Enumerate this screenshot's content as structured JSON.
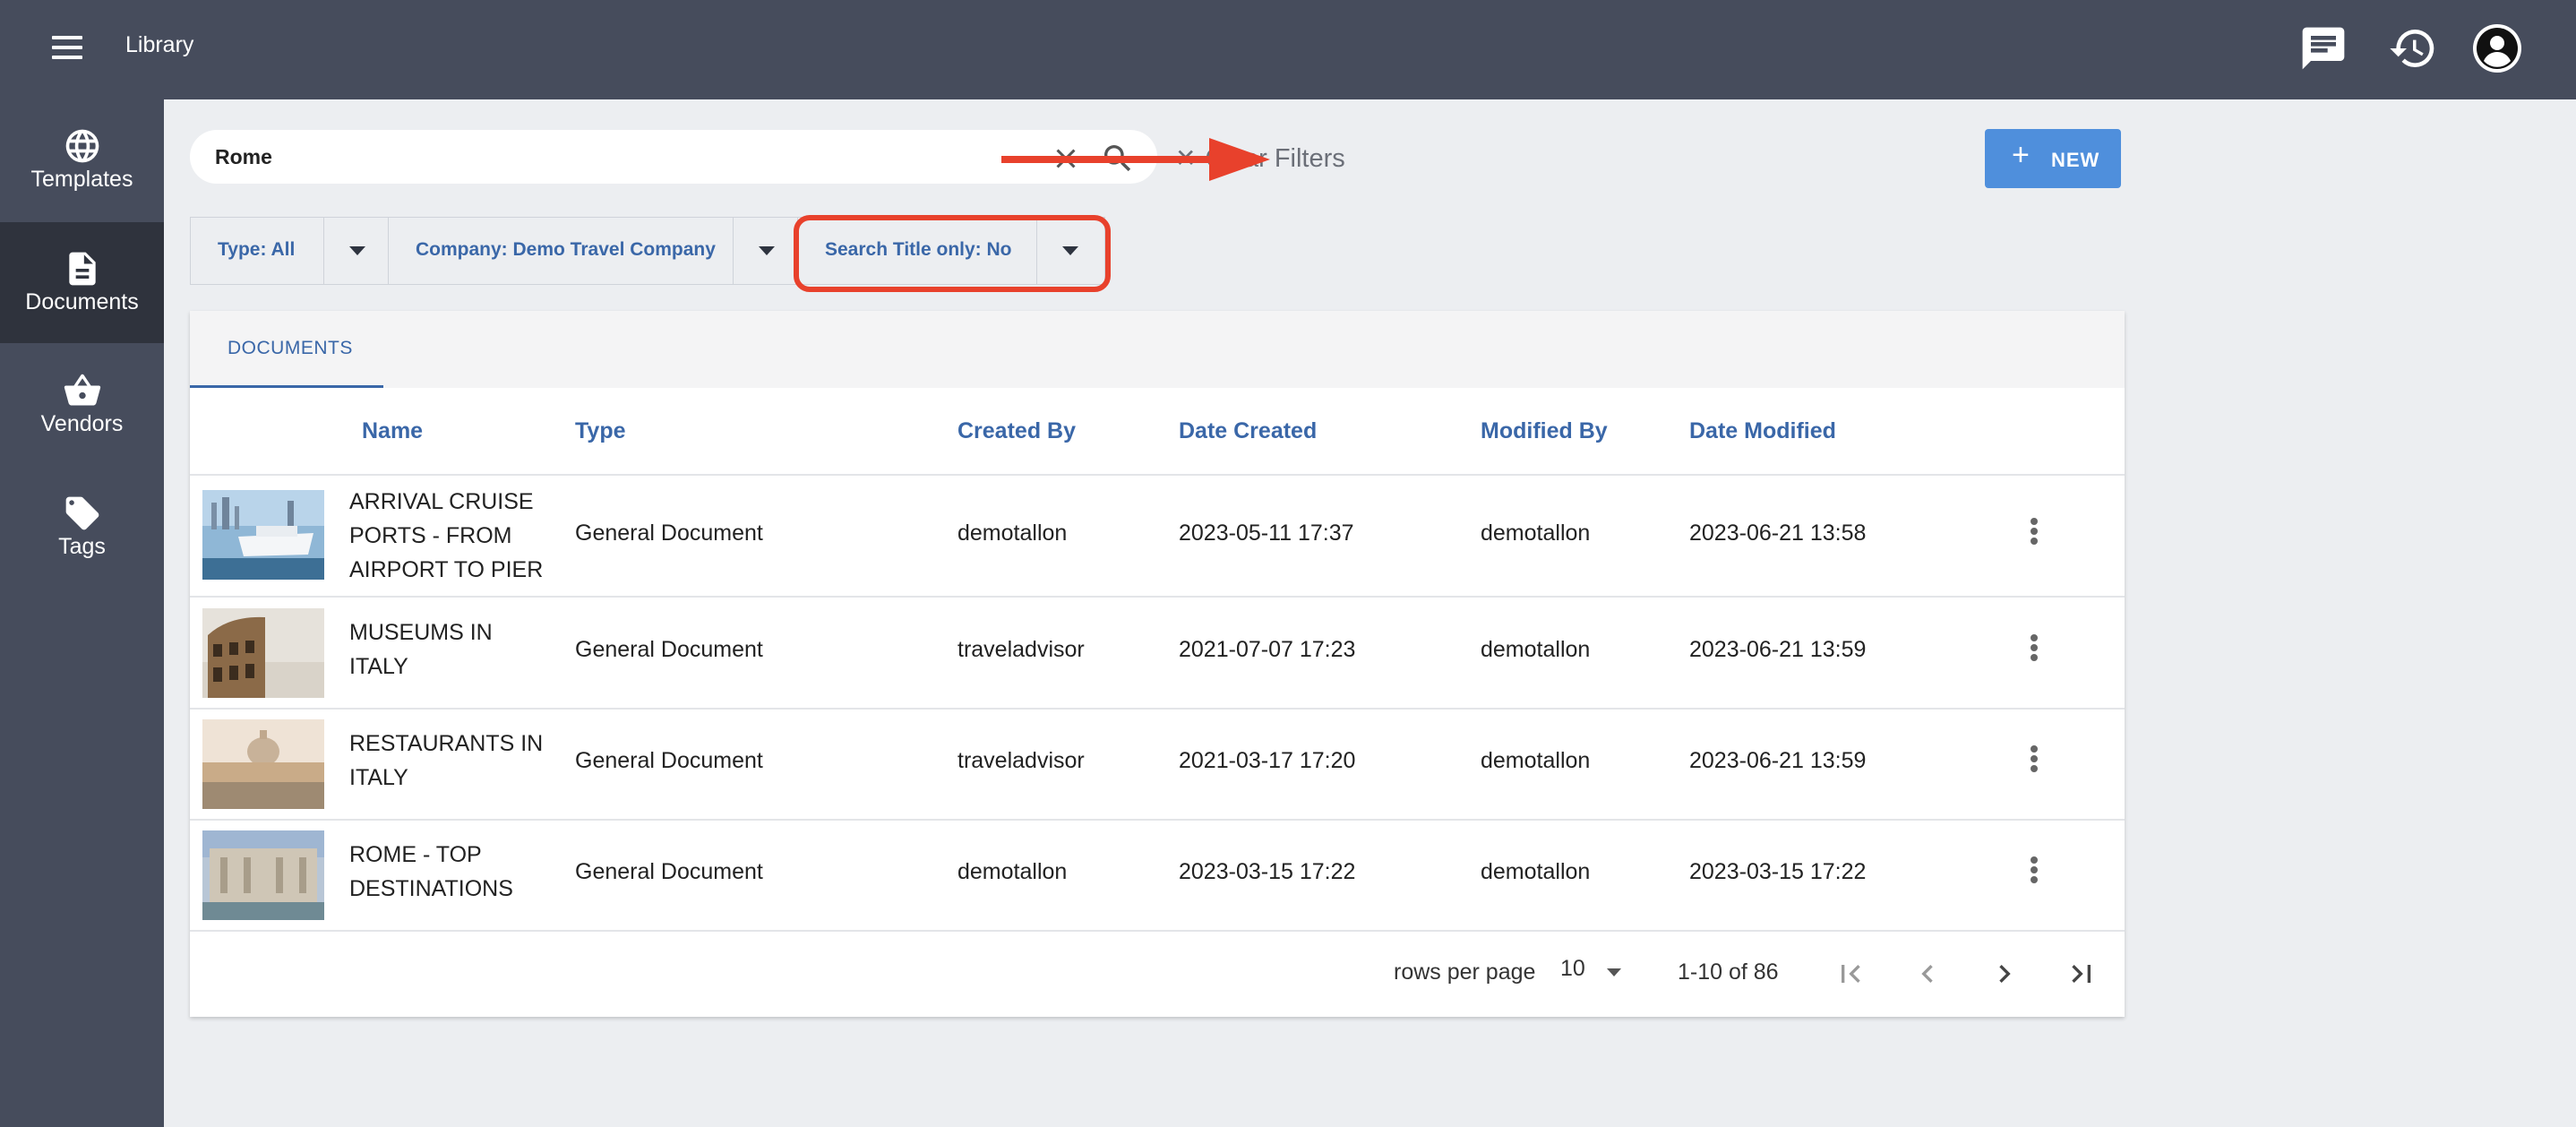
{
  "header": {
    "title": "Library",
    "icons": [
      "menu-icon",
      "chat-icon",
      "history-icon",
      "account-icon"
    ]
  },
  "sidebar": {
    "items": [
      {
        "label": "Templates",
        "icon": "globe-icon"
      },
      {
        "label": "Documents",
        "icon": "document-icon",
        "active": true
      },
      {
        "label": "Vendors",
        "icon": "basket-icon"
      },
      {
        "label": "Tags",
        "icon": "tag-icon"
      }
    ]
  },
  "search": {
    "value": "Rome",
    "clear_filters_label": "Clear Filters"
  },
  "toolbar": {
    "new_label": "NEW"
  },
  "filters": [
    {
      "label": "Type: All"
    },
    {
      "label": "Company: Demo Travel Company"
    },
    {
      "label": "Search Title only: No"
    }
  ],
  "tabs": [
    {
      "label": "DOCUMENTS",
      "active": true
    }
  ],
  "table": {
    "columns": [
      "Name",
      "Type",
      "Created By",
      "Date Created",
      "Modified By",
      "Date Modified"
    ],
    "rows": [
      {
        "name": "ARRIVAL CRUISE PORTS - FROM AIRPORT TO PIER",
        "type": "General Document",
        "created_by": "demotallon",
        "date_created": "2023-05-11 17:37",
        "modified_by": "demotallon",
        "date_modified": "2023-06-21 13:58"
      },
      {
        "name": "MUSEUMS IN ITALY",
        "type": "General Document",
        "created_by": "traveladvisor",
        "date_created": "2021-07-07 17:23",
        "modified_by": "demotallon",
        "date_modified": "2023-06-21 13:59"
      },
      {
        "name": "RESTAURANTS IN ITALY",
        "type": "General Document",
        "created_by": "traveladvisor",
        "date_created": "2021-03-17 17:20",
        "modified_by": "demotallon",
        "date_modified": "2023-06-21 13:59"
      },
      {
        "name": "ROME - TOP DESTINATIONS",
        "type": "General Document",
        "created_by": "demotallon",
        "date_created": "2023-03-15 17:22",
        "modified_by": "demotallon",
        "date_modified": "2023-03-15 17:22"
      }
    ]
  },
  "pagination": {
    "rows_per_page_label": "rows per page",
    "rows_per_page": "10",
    "range": "1-10 of 86"
  },
  "colors": {
    "topbar": "#464c5c",
    "accent": "#3a67a8",
    "new_button": "#4f8fdc",
    "annotation": "#e8412c"
  }
}
